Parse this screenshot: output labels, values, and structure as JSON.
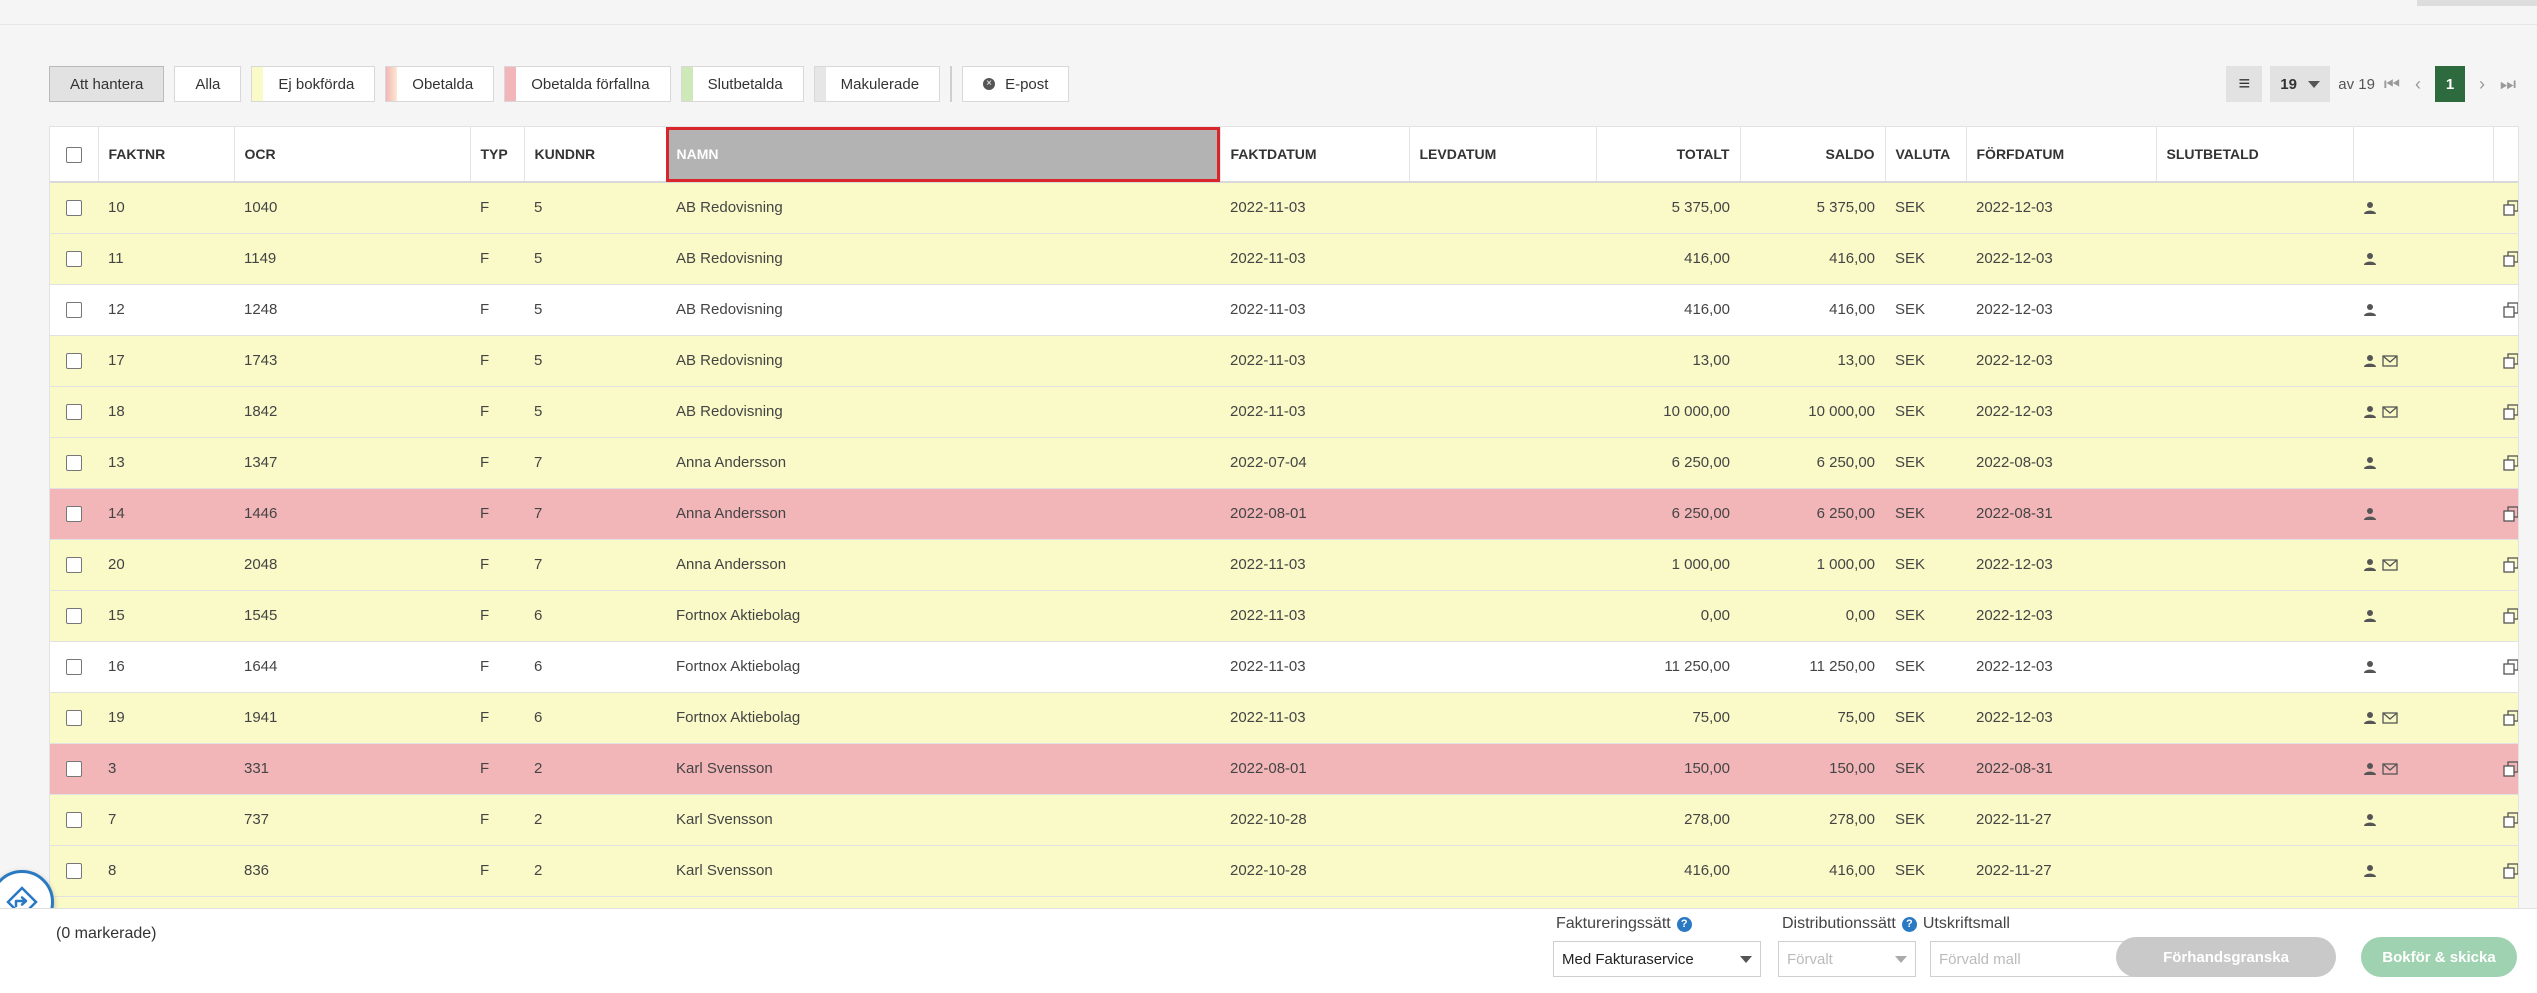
{
  "filters": [
    {
      "label": "Att hantera",
      "active": true,
      "swatch": ""
    },
    {
      "label": "Alla",
      "active": false,
      "swatch": ""
    },
    {
      "label": "Ej bokförda",
      "active": false,
      "swatch": "#fafac8"
    },
    {
      "label": "Obetalda",
      "active": false,
      "swatch": "linear-gradient(90deg,#f2b6b9 0%,#fde8cf 100%)"
    },
    {
      "label": "Obetalda förfallna",
      "active": false,
      "swatch": "#f2b6b9"
    },
    {
      "label": "Slutbetalda",
      "active": false,
      "swatch": "#cfe8b8"
    },
    {
      "label": "Makulerade",
      "active": false,
      "swatch": "#e6e6e6"
    }
  ],
  "email_button": "E-post",
  "pagination": {
    "page_size": "19",
    "of_label": "av 19",
    "current_page": "1"
  },
  "columns": {
    "faktnr": "FAKTNR",
    "ocr": "OCR",
    "typ": "TYP",
    "kundnr": "KUNDNR",
    "namn": "NAMN",
    "faktdatum": "FAKTDATUM",
    "levdatum": "LEVDATUM",
    "totalt": "TOTALT",
    "saldo": "SALDO",
    "valuta": "VALUTA",
    "forfdatum": "FÖRFDATUM",
    "slutbetald": "SLUTBETALD"
  },
  "rows": [
    {
      "status": "yellow",
      "faktnr": "10",
      "ocr": "1040",
      "typ": "F",
      "kundnr": "5",
      "namn": "AB Redovisning",
      "faktdatum": "2022-11-03",
      "levdatum": "",
      "totalt": "5 375,00",
      "saldo": "5 375,00",
      "valuta": "SEK",
      "forfdatum": "2022-12-03",
      "slutbetald": "",
      "mail": false
    },
    {
      "status": "yellow",
      "faktnr": "11",
      "ocr": "1149",
      "typ": "F",
      "kundnr": "5",
      "namn": "AB Redovisning",
      "faktdatum": "2022-11-03",
      "levdatum": "",
      "totalt": "416,00",
      "saldo": "416,00",
      "valuta": "SEK",
      "forfdatum": "2022-12-03",
      "slutbetald": "",
      "mail": false
    },
    {
      "status": "white",
      "faktnr": "12",
      "ocr": "1248",
      "typ": "F",
      "kundnr": "5",
      "namn": "AB Redovisning",
      "faktdatum": "2022-11-03",
      "levdatum": "",
      "totalt": "416,00",
      "saldo": "416,00",
      "valuta": "SEK",
      "forfdatum": "2022-12-03",
      "slutbetald": "",
      "mail": false
    },
    {
      "status": "yellow",
      "faktnr": "17",
      "ocr": "1743",
      "typ": "F",
      "kundnr": "5",
      "namn": "AB Redovisning",
      "faktdatum": "2022-11-03",
      "levdatum": "",
      "totalt": "13,00",
      "saldo": "13,00",
      "valuta": "SEK",
      "forfdatum": "2022-12-03",
      "slutbetald": "",
      "mail": true
    },
    {
      "status": "yellow",
      "faktnr": "18",
      "ocr": "1842",
      "typ": "F",
      "kundnr": "5",
      "namn": "AB Redovisning",
      "faktdatum": "2022-11-03",
      "levdatum": "",
      "totalt": "10 000,00",
      "saldo": "10 000,00",
      "valuta": "SEK",
      "forfdatum": "2022-12-03",
      "slutbetald": "",
      "mail": true
    },
    {
      "status": "yellow",
      "faktnr": "13",
      "ocr": "1347",
      "typ": "F",
      "kundnr": "7",
      "namn": "Anna Andersson",
      "faktdatum": "2022-07-04",
      "levdatum": "",
      "totalt": "6 250,00",
      "saldo": "6 250,00",
      "valuta": "SEK",
      "forfdatum": "2022-08-03",
      "slutbetald": "",
      "mail": false
    },
    {
      "status": "red",
      "faktnr": "14",
      "ocr": "1446",
      "typ": "F",
      "kundnr": "7",
      "namn": "Anna Andersson",
      "faktdatum": "2022-08-01",
      "levdatum": "",
      "totalt": "6 250,00",
      "saldo": "6 250,00",
      "valuta": "SEK",
      "forfdatum": "2022-08-31",
      "slutbetald": "",
      "mail": false
    },
    {
      "status": "yellow",
      "faktnr": "20",
      "ocr": "2048",
      "typ": "F",
      "kundnr": "7",
      "namn": "Anna Andersson",
      "faktdatum": "2022-11-03",
      "levdatum": "",
      "totalt": "1 000,00",
      "saldo": "1 000,00",
      "valuta": "SEK",
      "forfdatum": "2022-12-03",
      "slutbetald": "",
      "mail": true
    },
    {
      "status": "yellow",
      "faktnr": "15",
      "ocr": "1545",
      "typ": "F",
      "kundnr": "6",
      "namn": "Fortnox Aktiebolag",
      "faktdatum": "2022-11-03",
      "levdatum": "",
      "totalt": "0,00",
      "saldo": "0,00",
      "valuta": "SEK",
      "forfdatum": "2022-12-03",
      "slutbetald": "",
      "mail": false
    },
    {
      "status": "white",
      "faktnr": "16",
      "ocr": "1644",
      "typ": "F",
      "kundnr": "6",
      "namn": "Fortnox Aktiebolag",
      "faktdatum": "2022-11-03",
      "levdatum": "",
      "totalt": "11 250,00",
      "saldo": "11 250,00",
      "valuta": "SEK",
      "forfdatum": "2022-12-03",
      "slutbetald": "",
      "mail": false
    },
    {
      "status": "yellow",
      "faktnr": "19",
      "ocr": "1941",
      "typ": "F",
      "kundnr": "6",
      "namn": "Fortnox Aktiebolag",
      "faktdatum": "2022-11-03",
      "levdatum": "",
      "totalt": "75,00",
      "saldo": "75,00",
      "valuta": "SEK",
      "forfdatum": "2022-12-03",
      "slutbetald": "",
      "mail": true
    },
    {
      "status": "red",
      "faktnr": "3",
      "ocr": "331",
      "typ": "F",
      "kundnr": "2",
      "namn": "Karl Svensson",
      "faktdatum": "2022-08-01",
      "levdatum": "",
      "totalt": "150,00",
      "saldo": "150,00",
      "valuta": "SEK",
      "forfdatum": "2022-08-31",
      "slutbetald": "",
      "mail": true
    },
    {
      "status": "yellow",
      "faktnr": "7",
      "ocr": "737",
      "typ": "F",
      "kundnr": "2",
      "namn": "Karl Svensson",
      "faktdatum": "2022-10-28",
      "levdatum": "",
      "totalt": "278,00",
      "saldo": "278,00",
      "valuta": "SEK",
      "forfdatum": "2022-11-27",
      "slutbetald": "",
      "mail": false
    },
    {
      "status": "yellow",
      "faktnr": "8",
      "ocr": "836",
      "typ": "F",
      "kundnr": "2",
      "namn": "Karl Svensson",
      "faktdatum": "2022-10-28",
      "levdatum": "",
      "totalt": "416,00",
      "saldo": "416,00",
      "valuta": "SEK",
      "forfdatum": "2022-11-27",
      "slutbetald": "",
      "mail": false
    },
    {
      "status": "yellow",
      "faktnr": "",
      "ocr": "",
      "typ": "",
      "kundnr": "",
      "namn": "",
      "faktdatum": "",
      "levdatum": "",
      "totalt": "",
      "saldo": "",
      "valuta": "",
      "forfdatum": "",
      "slutbetald": "",
      "mail": false
    }
  ],
  "bottom": {
    "marked": "(0 markerade)",
    "faktureringssatt_label": "Faktureringssätt",
    "faktureringssatt_value": "Med Fakturaservice",
    "distributionssatt_label": "Distributionssätt",
    "distributionssatt_value": "Förvalt",
    "utskriftsmall_label": "Utskriftsmall",
    "utskriftsmall_value": "Förvald mall",
    "preview_button": "Förhandsgranska",
    "book_send_button": "Bokför & skicka"
  },
  "colors": {
    "accent_green": "#2d6a3e",
    "red_row": "#f2b6b9",
    "yellow_row": "#fafac8",
    "highlight_border": "#d9262c"
  }
}
